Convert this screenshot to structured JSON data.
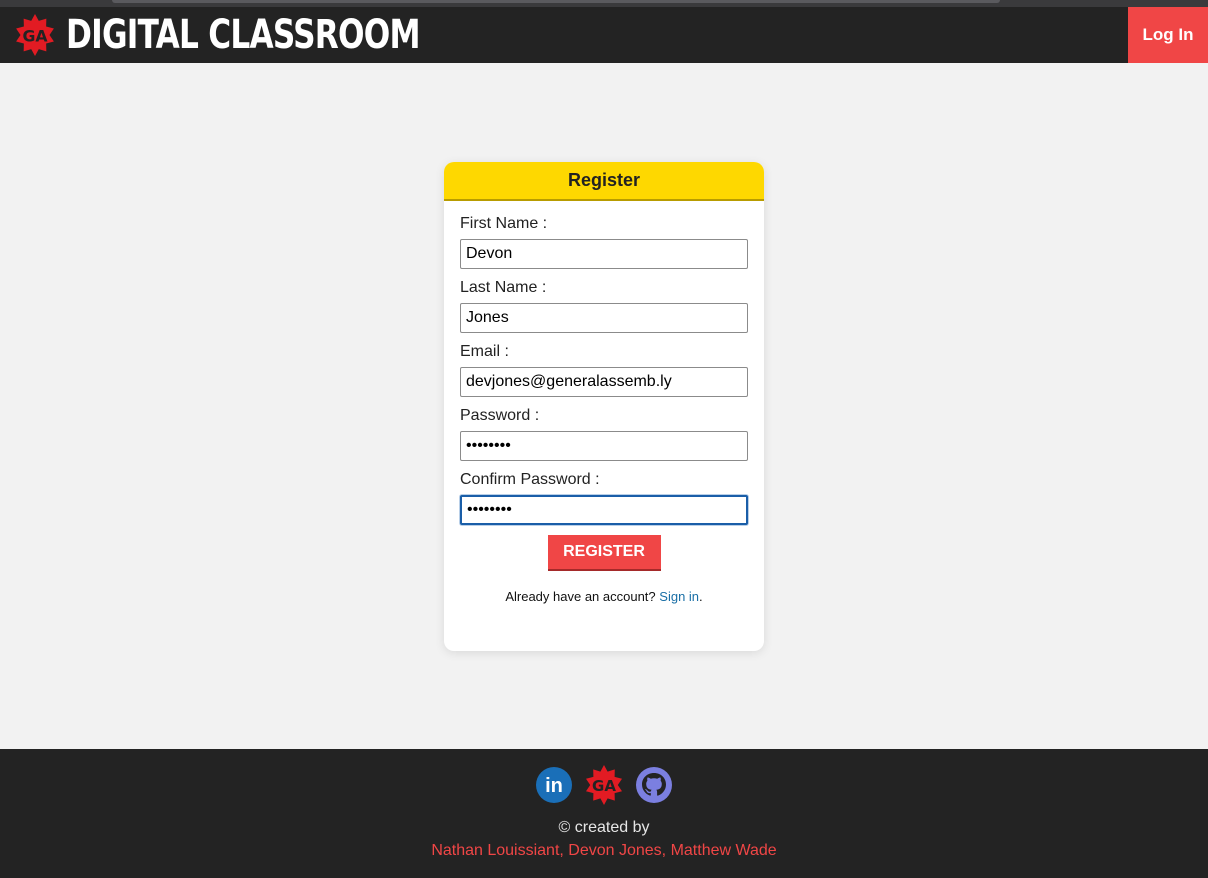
{
  "header": {
    "brand_badge_text": "GA",
    "brand_title": "DIGITAL CLASSROOM",
    "login_label": "Log In"
  },
  "register_form": {
    "title": "Register",
    "fields": [
      {
        "label": "First Name :",
        "value": "Devon",
        "type": "text"
      },
      {
        "label": "Last Name :",
        "value": "Jones",
        "type": "text"
      },
      {
        "label": "Email :",
        "value": "devjones@generalassemb.ly",
        "type": "email"
      },
      {
        "label": "Password :",
        "value": "xxxxxxxx",
        "type": "password"
      },
      {
        "label": "Confirm Password :",
        "value": "xxxxxxxx",
        "type": "password"
      }
    ],
    "submit_label": "REGISTER",
    "signin_prompt": "Already have an account?",
    "signin_link": "Sign in",
    "signin_suffix": "."
  },
  "footer": {
    "icons": [
      "linkedin-icon",
      "ga-logo-icon",
      "github-icon"
    ],
    "linkedin_text": "in",
    "ga_text": "GA",
    "credit": "© created by",
    "authors": "Nathan Louissiant, Devon Jones, Matthew Wade"
  },
  "colors": {
    "nav_bg": "#232323",
    "accent_red": "#f04646",
    "header_yellow": "#fed800",
    "page_bg": "#f2f2f2",
    "link_blue": "#1a6fa6",
    "linkedin_blue": "#1a6fb8",
    "github_purple": "#7b7fe0"
  }
}
